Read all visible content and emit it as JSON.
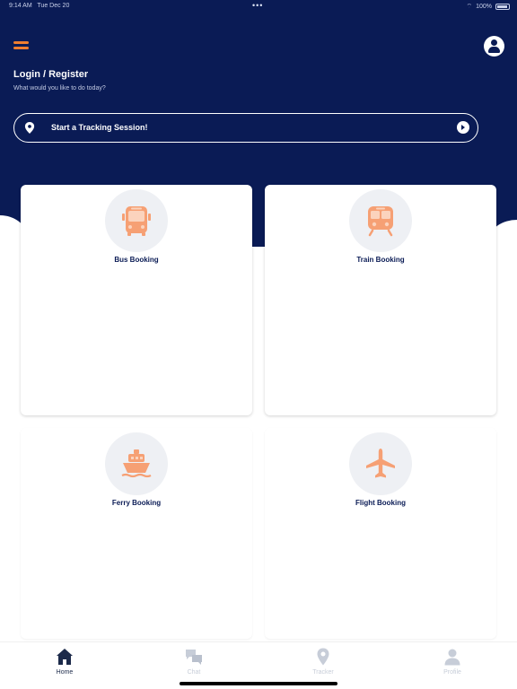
{
  "status_bar": {
    "time": "9:14 AM",
    "date": "Tue Dec 20",
    "battery": "100%"
  },
  "header": {
    "title": "Login / Register",
    "subtitle": "What would you like to do today?"
  },
  "tracking": {
    "label": "Start a Tracking Session!"
  },
  "cards": [
    {
      "label": "Bus Booking",
      "icon": "bus-icon"
    },
    {
      "label": "Train Booking",
      "icon": "train-icon"
    },
    {
      "label": "Ferry Booking",
      "icon": "ferry-icon"
    },
    {
      "label": "Flight Booking",
      "icon": "airplane-icon"
    }
  ],
  "tabs": [
    {
      "label": "Home",
      "icon": "home-icon",
      "active": true
    },
    {
      "label": "Chat",
      "icon": "chat-icon",
      "active": false
    },
    {
      "label": "Tracker",
      "icon": "map-pin-icon",
      "active": false
    },
    {
      "label": "Profile",
      "icon": "user-icon",
      "active": false
    }
  ],
  "colors": {
    "brand_navy": "#0a1b55",
    "accent_orange": "#f07e2f",
    "icon_peach": "#f6a074",
    "inactive_tab": "#c7cdd8"
  }
}
